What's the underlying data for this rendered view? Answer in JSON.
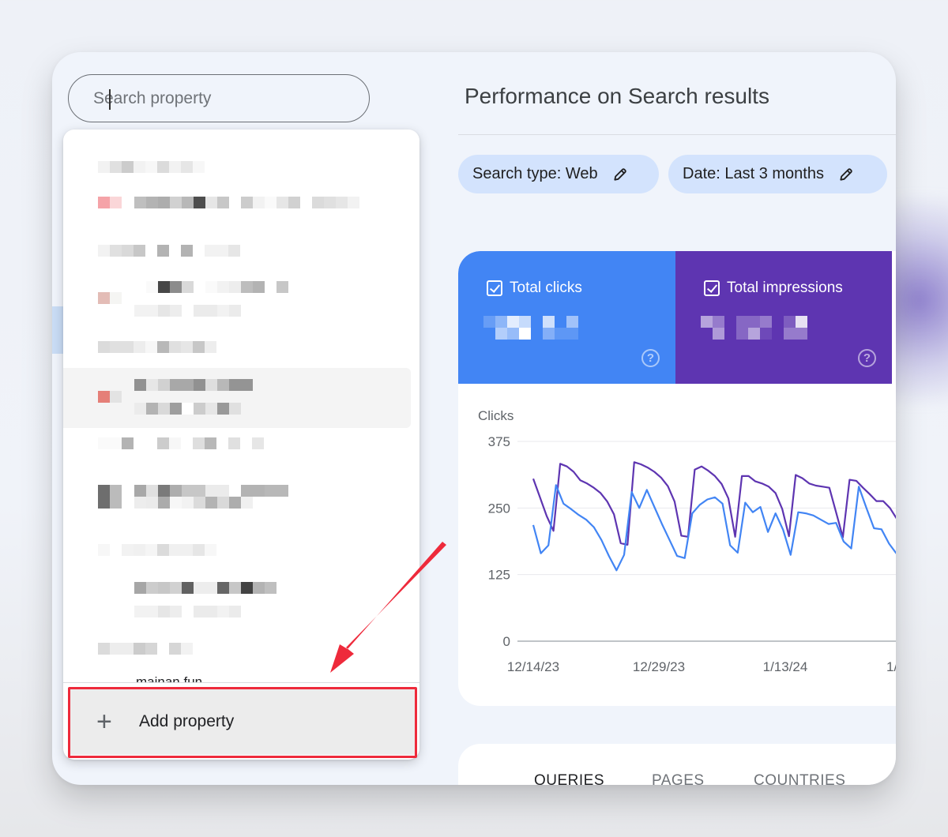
{
  "search": {
    "placeholder": "Search property",
    "value": ""
  },
  "property_list": {
    "partial_item_label": "mainan.fun",
    "add_property_label": "Add property",
    "add_icon": "plus-icon"
  },
  "header": {
    "title": "Performance on Search results"
  },
  "filters": [
    {
      "label": "Search type: Web",
      "icon": "pencil-icon"
    },
    {
      "label": "Date: Last 3 months",
      "icon": "pencil-icon"
    }
  ],
  "metrics": [
    {
      "label": "Total clicks",
      "checked": true,
      "value": "[redacted]",
      "color": "#4285f4",
      "help_icon": "help-icon"
    },
    {
      "label": "Total impressions",
      "checked": true,
      "value": "[redacted]",
      "color": "#5e35b1",
      "help_icon": "help-icon"
    }
  ],
  "tabs": [
    {
      "label": "QUERIES",
      "active": true
    },
    {
      "label": "PAGES",
      "active": false
    },
    {
      "label": "COUNTRIES",
      "active": false
    }
  ],
  "annotation": {
    "type": "red-arrow-and-box",
    "target": "Add property",
    "color": "#ee2a3b"
  },
  "chart_data": {
    "type": "line",
    "title": "",
    "ylabel": "Clicks",
    "xlabel": "",
    "ylim": [
      0,
      375
    ],
    "yticks": [
      "0",
      "125",
      "250",
      "375"
    ],
    "xticks": [
      "12/14/23",
      "12/29/23",
      "1/13/24",
      "1/"
    ],
    "grid": true,
    "legend": "none",
    "x": [
      "12/14",
      "12/15",
      "12/16",
      "12/17",
      "12/18",
      "12/19",
      "12/20",
      "12/21",
      "12/22",
      "12/23",
      "12/24",
      "12/25",
      "12/26",
      "12/27",
      "12/28",
      "12/29",
      "12/30",
      "12/31",
      "1/1",
      "1/2",
      "1/3",
      "1/4",
      "1/5",
      "1/6",
      "1/7",
      "1/8",
      "1/9",
      "1/10",
      "1/11",
      "1/12",
      "1/13",
      "1/14",
      "1/15",
      "1/16",
      "1/17",
      "1/18",
      "1/19",
      "1/20",
      "1/21",
      "1/22",
      "1/23",
      "1/24",
      "1/25",
      "1/26",
      "1/27",
      "1/28",
      "1/29",
      "1/30"
    ],
    "series": [
      {
        "name": "Total impressions",
        "color": "#5e35b1",
        "values": [
          305,
          270,
          235,
          207,
          333,
          328,
          318,
          302,
          296,
          288,
          278,
          262,
          238,
          184,
          181,
          336,
          332,
          326,
          318,
          307,
          291,
          262,
          198,
          196,
          322,
          328,
          320,
          310,
          295,
          268,
          196,
          310,
          310,
          300,
          296,
          290,
          278,
          248,
          197,
          312,
          306,
          296,
          292,
          290,
          288,
          242,
          195,
          303,
          301,
          288,
          276,
          263,
          263,
          250,
          230
        ]
      },
      {
        "name": "Total clicks",
        "color": "#4285f4",
        "values": [
          218,
          165,
          180,
          293,
          258,
          248,
          237,
          228,
          214,
          190,
          160,
          133,
          162,
          280,
          250,
          284,
          252,
          220,
          190,
          160,
          156,
          240,
          256,
          266,
          270,
          258,
          180,
          166,
          260,
          242,
          252,
          205,
          240,
          209,
          162,
          242,
          240,
          236,
          228,
          220,
          222,
          187,
          174,
          290,
          250,
          212,
          210,
          183,
          164
        ]
      }
    ]
  }
}
